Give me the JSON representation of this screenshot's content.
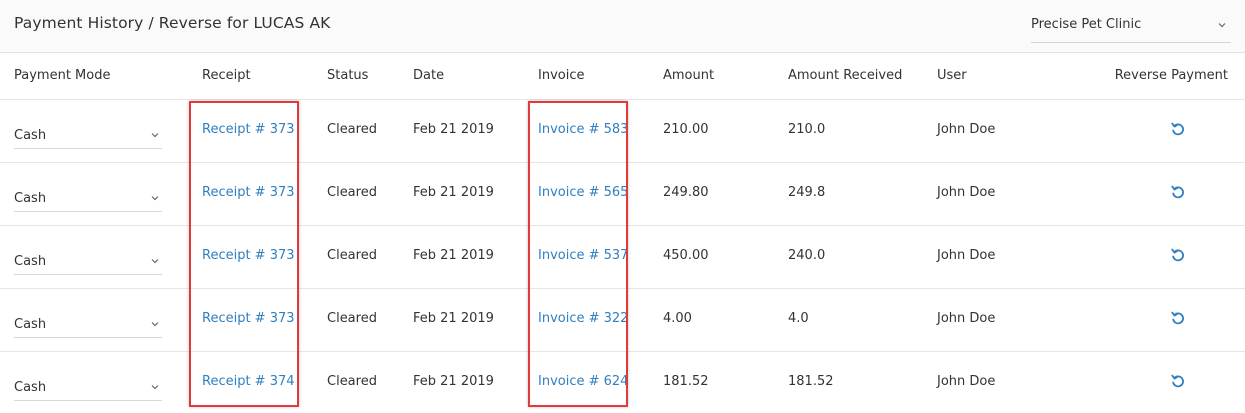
{
  "header": {
    "title": "Payment History / Reverse for LUCAS AK",
    "clinic": "Precise Pet Clinic"
  },
  "columns": {
    "payment_mode": "Payment Mode",
    "receipt": "Receipt",
    "status": "Status",
    "date": "Date",
    "invoice": "Invoice",
    "amount": "Amount",
    "amount_received": "Amount Received",
    "user": "User",
    "reverse": "Reverse Payment"
  },
  "rows": [
    {
      "mode": "Cash",
      "receipt": "Receipt # 373",
      "status": "Cleared",
      "date": "Feb 21 2019",
      "invoice": "Invoice # 583",
      "amount": "210.00",
      "received": "210.0",
      "user": "John Doe"
    },
    {
      "mode": "Cash",
      "receipt": "Receipt # 373",
      "status": "Cleared",
      "date": "Feb 21 2019",
      "invoice": "Invoice # 565",
      "amount": "249.80",
      "received": "249.8",
      "user": "John Doe"
    },
    {
      "mode": "Cash",
      "receipt": "Receipt # 373",
      "status": "Cleared",
      "date": "Feb 21 2019",
      "invoice": "Invoice # 537",
      "amount": "450.00",
      "received": "240.0",
      "user": "John Doe"
    },
    {
      "mode": "Cash",
      "receipt": "Receipt # 373",
      "status": "Cleared",
      "date": "Feb 21 2019",
      "invoice": "Invoice # 322",
      "amount": "4.00",
      "received": "4.0",
      "user": "John Doe"
    },
    {
      "mode": "Cash",
      "receipt": "Receipt # 374",
      "status": "Cleared",
      "date": "Feb 21 2019",
      "invoice": "Invoice # 624",
      "amount": "181.52",
      "received": "181.52",
      "user": "John Doe"
    }
  ],
  "icons": {
    "mode_dropdown": "chevron-down-icon",
    "clinic_dropdown": "chevron-down-icon",
    "reverse": "undo-icon"
  },
  "colors": {
    "link": "#2f7fc1",
    "highlight": "#e03a3a",
    "reverse_icon": "#2f7fc1"
  }
}
